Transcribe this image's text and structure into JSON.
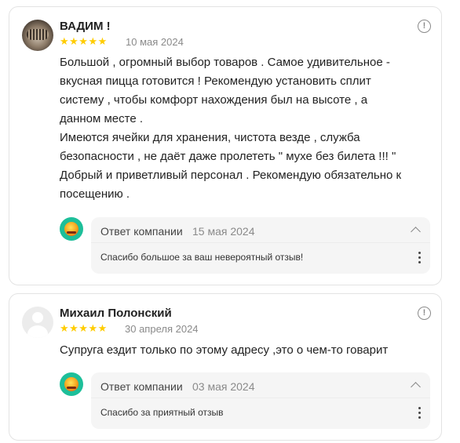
{
  "reviews": [
    {
      "author": "ВАДИМ !",
      "stars": "★★★★★",
      "rating": 5,
      "date": "10 мая 2024",
      "text_lines": [
        "Большой , огромный выбор товаров . Самое удивительное -",
        "вкусная пицца готовится ! Рекомендую установить сплит",
        "систему , чтобы комфорт нахождения был на высоте , а",
        "данном месте .",
        "Имеются ячейки для хранения, чистота везде , служба",
        "безопасности , не даёт даже пролететь \" мухе без билета !!! \"",
        "Добрый и приветливый персонал . Рекомендую обязательно к",
        "посещению ."
      ],
      "reply": {
        "label": "Ответ компании",
        "date": "15 мая 2024",
        "text": "Спасибо большое за ваш невероятный отзыв!"
      },
      "avatar_icon": "user-photo",
      "info_icon": "info-icon"
    },
    {
      "author": "Михаил Полонский",
      "stars": "★★★★★",
      "rating": 5,
      "date": "30 апреля 2024",
      "text_lines": [
        "Супруга ездит только по этому адресу ,это о чем-то говарит"
      ],
      "reply": {
        "label": "Ответ компании",
        "date": "03 мая 2024",
        "text": "Спасибо за приятный отзыв"
      },
      "avatar_icon": "user-placeholder",
      "info_icon": "info-icon"
    }
  ],
  "icons": {
    "info": "!",
    "collapse": "chevron-up-icon",
    "more": "more-vertical-icon"
  },
  "colors": {
    "star": "#ffcc00",
    "muted": "#8a8a8a",
    "reply_bg": "#f5f5f5",
    "company_logo": "#1dbf9a"
  }
}
